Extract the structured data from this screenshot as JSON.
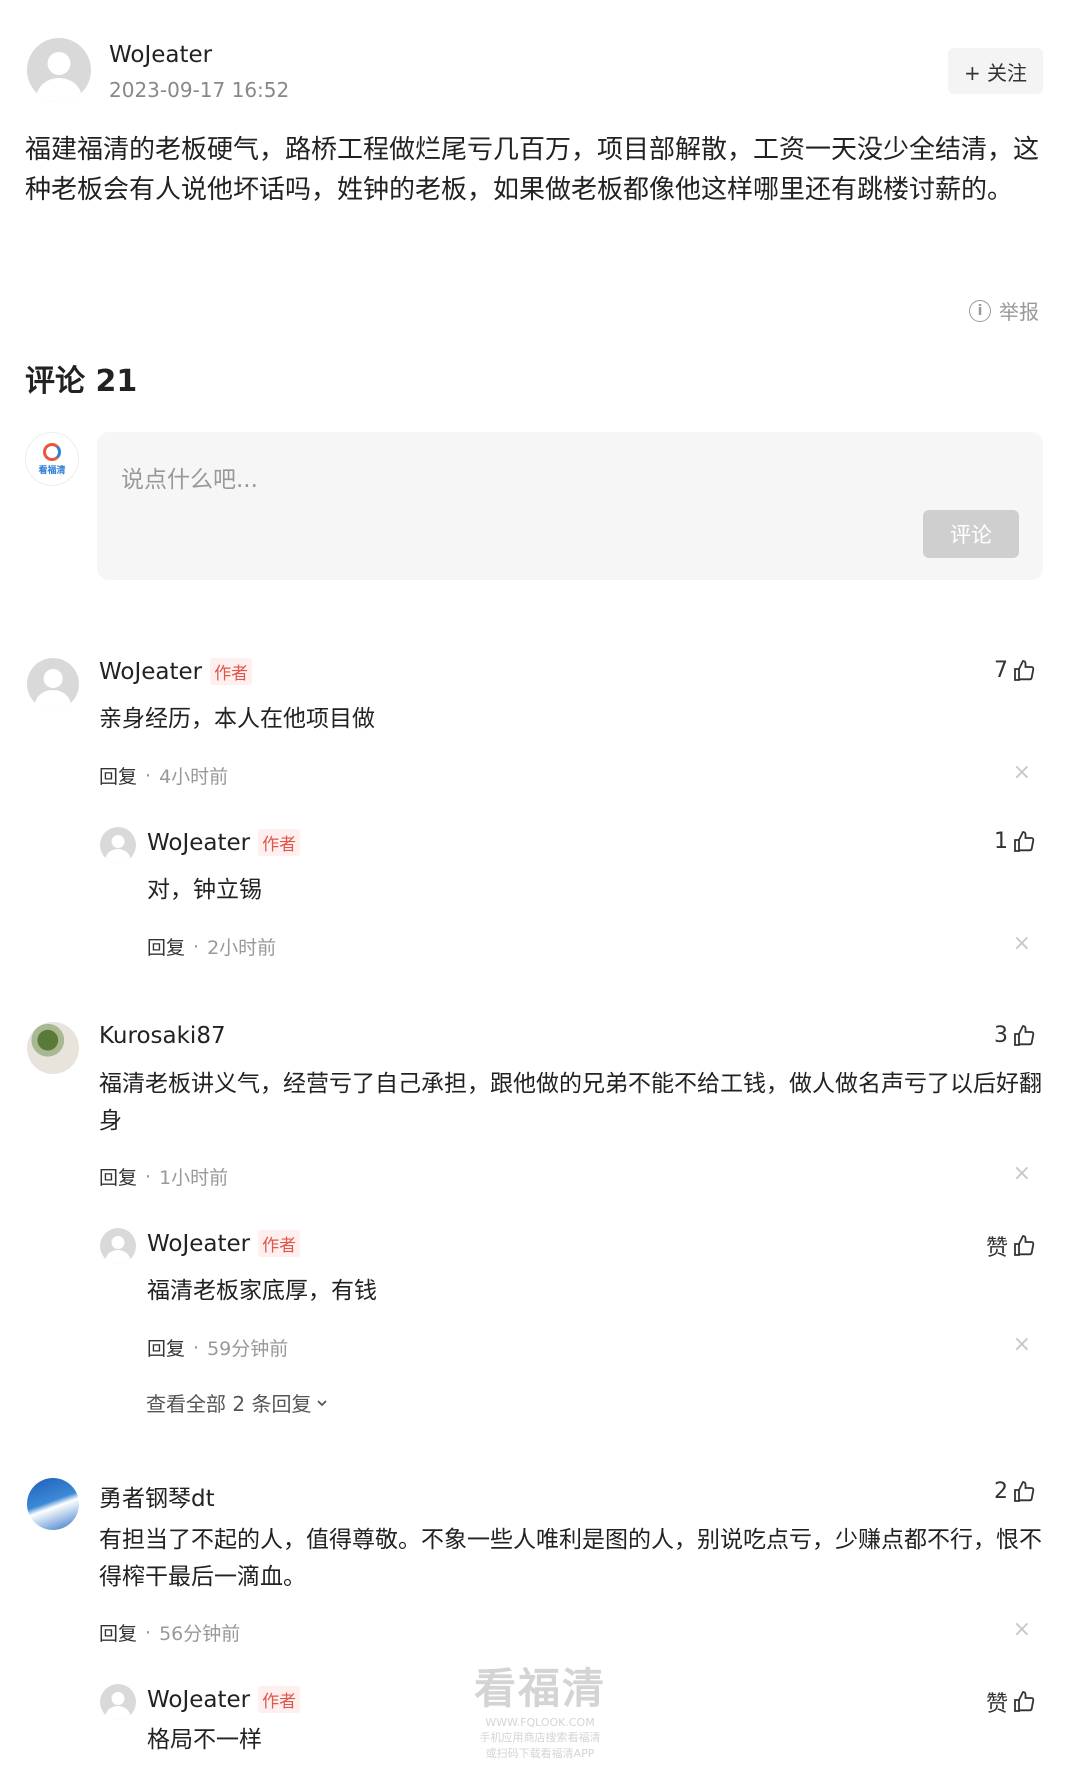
{
  "post": {
    "author": "WoJeater",
    "time": "2023-09-17 16:52",
    "follow_label": "+ 关注",
    "body": "福建福清的老板硬气，路桥工程做烂尾亏几百万，项目部解散，工资一天没少全结清，这种老板会有人说他坏话吗，姓钟的老板，如果做老板都像他这样哪里还有跳楼讨薪的。",
    "report_label": "举报"
  },
  "comments_heading": "评论 21",
  "input": {
    "placeholder": "说点什么吧...",
    "submit_label": "评论",
    "my_avatar_text": "看福清"
  },
  "comments": [
    {
      "author": "WoJeater",
      "tag": "作者",
      "text": "亲身经历，本人在他项目做",
      "reply_label": "回复",
      "time": "4小时前",
      "likes": "7",
      "replies": [
        {
          "author": "WoJeater",
          "tag": "作者",
          "text": "对，钟立锡",
          "reply_label": "回复",
          "time": "2小时前",
          "likes": "1"
        }
      ]
    },
    {
      "author": "Kurosaki87",
      "text": "福清老板讲义气，经营亏了自己承担，跟他做的兄弟不能不给工钱，做人做名声亏了以后好翻身",
      "reply_label": "回复",
      "time": "1小时前",
      "likes": "3",
      "replies": [
        {
          "author": "WoJeater",
          "tag": "作者",
          "text": "福清老板家底厚，有钱",
          "reply_label": "回复",
          "time": "59分钟前",
          "likes": "赞"
        }
      ],
      "view_all": "查看全部 2 条回复"
    },
    {
      "author": "勇者钢琴dt",
      "text": "有担当了不起的人，值得尊敬。不象一些人唯利是图的人，别说吃点亏，少赚点都不行，恨不得榨干最后一滴血。",
      "reply_label": "回复",
      "time": "56分钟前",
      "likes": "2",
      "replies": [
        {
          "author": "WoJeater",
          "tag": "作者",
          "text": "格局不一样",
          "likes": "赞"
        }
      ]
    }
  ],
  "meta_separator": "·",
  "close_glyph": "×",
  "watermark": {
    "title": "看福清",
    "url": "WWW.FQLOOK.COM",
    "line1": "手机应用商店搜索看福清",
    "line2": "或扫码下载看福清APP"
  },
  "colors": {
    "author_tag": "#e0564a",
    "muted": "#999999",
    "submit_disabled": "#cfcfcf"
  }
}
